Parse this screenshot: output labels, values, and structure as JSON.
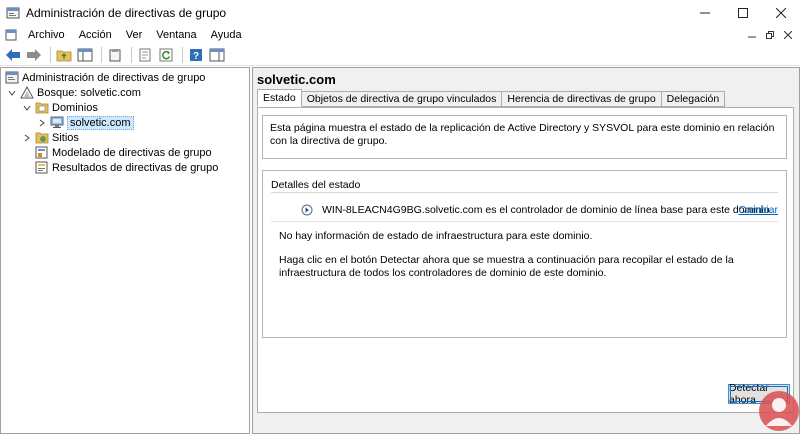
{
  "window": {
    "title": "Administración de directivas de grupo",
    "controls": [
      "minimize",
      "maximize",
      "close"
    ]
  },
  "menu": {
    "items": [
      "Archivo",
      "Acción",
      "Ver",
      "Ventana",
      "Ayuda"
    ]
  },
  "toolbar": {
    "icons": [
      "back-arrow-icon",
      "forward-arrow-icon",
      "folder-up-icon",
      "console-tree-icon",
      "clipboard-icon",
      "properties-icon",
      "refresh-icon",
      "help-icon",
      "action-pane-icon"
    ]
  },
  "tree": {
    "root": "Administración de directivas de grupo",
    "forest": "Bosque: solvetic.com",
    "domains": "Dominios",
    "domain": "solvetic.com",
    "sites": "Sitios",
    "modeling": "Modelado de directivas de grupo",
    "results": "Resultados de directivas de grupo"
  },
  "main": {
    "title": "solvetic.com",
    "tabs": [
      "Estado",
      "Objetos de directiva de grupo vinculados",
      "Herencia de directivas de grupo",
      "Delegación"
    ],
    "active_tab": "Estado",
    "description": "Esta página muestra el estado de la replicación de Active Directory y SYSVOL para este dominio en relación con la directiva de grupo.",
    "details": {
      "title": "Detalles del estado",
      "dc_text": "WIN-8LEACN4G9BG.solvetic.com es el controlador de dominio de línea base para este dominio.",
      "change_link": "Cambiar",
      "no_info": "No hay información de estado de infraestructura para este dominio.",
      "hint": "Haga clic en el botón Detectar ahora que se muestra a continuación para recopilar el estado de la infraestructura de todos los controladores de dominio de este dominio."
    },
    "detect_button": "Detectar ahora"
  }
}
